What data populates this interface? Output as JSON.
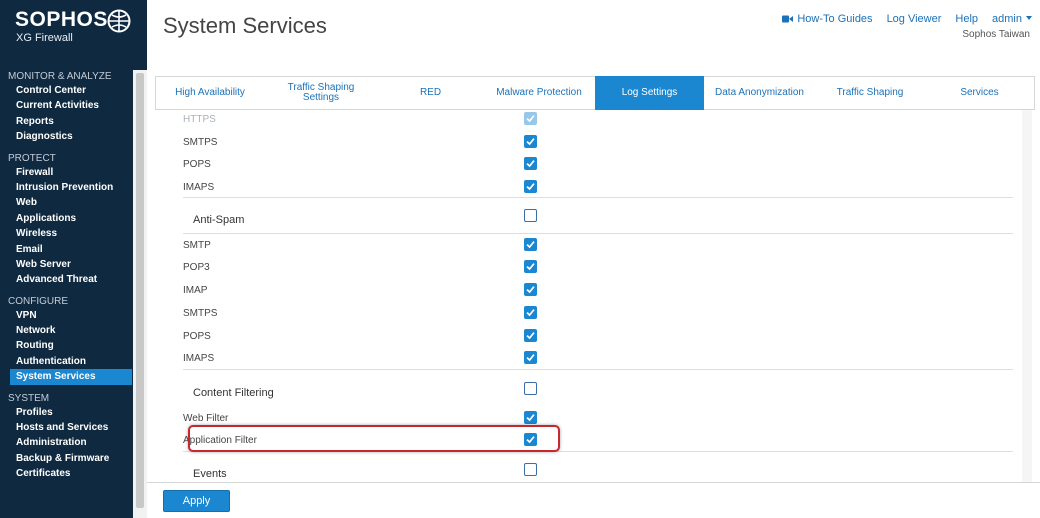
{
  "brand": {
    "name": "SOPHOS",
    "product": "XG Firewall"
  },
  "sidebar": {
    "sections": [
      {
        "title": "MONITOR & ANALYZE",
        "items": [
          "Control Center",
          "Current Activities",
          "Reports",
          "Diagnostics"
        ]
      },
      {
        "title": "PROTECT",
        "items": [
          "Firewall",
          "Intrusion Prevention",
          "Web",
          "Applications",
          "Wireless",
          "Email",
          "Web Server",
          "Advanced Threat"
        ]
      },
      {
        "title": "CONFIGURE",
        "items": [
          "VPN",
          "Network",
          "Routing",
          "Authentication",
          "System Services"
        ]
      },
      {
        "title": "SYSTEM",
        "items": [
          "Profiles",
          "Hosts and Services",
          "Administration",
          "Backup & Firmware",
          "Certificates"
        ]
      }
    ],
    "active_item": "System Services"
  },
  "header": {
    "title": "System Services",
    "links": {
      "howto": "How-To Guides",
      "logviewer": "Log Viewer",
      "help": "Help",
      "admin": "admin"
    },
    "org": "Sophos Taiwan"
  },
  "tabs": {
    "items": [
      {
        "label": "High Availability"
      },
      {
        "label": "Traffic Shaping Settings"
      },
      {
        "label": "RED"
      },
      {
        "label": "Malware Protection"
      },
      {
        "label": "Log Settings",
        "active": true
      },
      {
        "label": "Data Anonymization"
      },
      {
        "label": "Traffic Shaping"
      },
      {
        "label": "Services"
      }
    ]
  },
  "log_rows": [
    {
      "label": "HTTPS",
      "checked": true,
      "faded": true
    },
    {
      "label": "SMTPS",
      "checked": true
    },
    {
      "label": "POPS",
      "checked": true
    },
    {
      "label": "IMAPS",
      "checked": true
    },
    {
      "label": "Anti-Spam",
      "checked": false,
      "group": true
    },
    {
      "label": "SMTP",
      "checked": true
    },
    {
      "label": "POP3",
      "checked": true
    },
    {
      "label": "IMAP",
      "checked": true
    },
    {
      "label": "SMTPS",
      "checked": true
    },
    {
      "label": "POPS",
      "checked": true
    },
    {
      "label": "IMAPS",
      "checked": true
    },
    {
      "label": "Content Filtering",
      "checked": false,
      "group": true
    },
    {
      "label": "Web Filter",
      "checked": true
    },
    {
      "label": "Application Filter",
      "checked": true,
      "highlighted": true
    },
    {
      "label": "Events",
      "checked": false,
      "group": true
    }
  ],
  "footer": {
    "apply": "Apply"
  },
  "colors": {
    "sidebar_bg": "#0f2940",
    "accent": "#1b87d0",
    "link": "#1b72b8",
    "highlight": "#c5282e"
  }
}
